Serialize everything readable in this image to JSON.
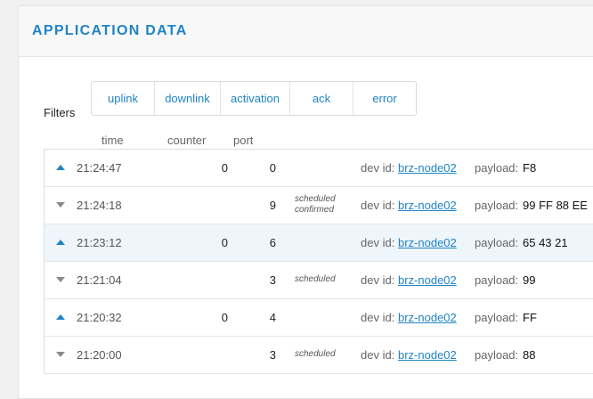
{
  "panel": {
    "title": "APPLICATION DATA"
  },
  "filters": {
    "label": "Filters",
    "buttons": [
      {
        "label": "uplink"
      },
      {
        "label": "downlink"
      },
      {
        "label": "activation"
      },
      {
        "label": "ack"
      },
      {
        "label": "error"
      }
    ]
  },
  "columns": {
    "time": "time",
    "counter": "counter",
    "port": "port"
  },
  "labels": {
    "dev_id": "dev id:",
    "payload": "payload:"
  },
  "colors": {
    "accent": "#1f84c6",
    "highlight_row": "#eef5fb",
    "uplink_arrow": "#1f84c6",
    "downlink_arrow": "#8a8a8a"
  },
  "rows": [
    {
      "direction": "uplink",
      "direction_icon": "triangle-up-icon",
      "time": "21:24:47",
      "counter": "0",
      "port": "0",
      "flags": [],
      "dev_id": "brz-node02",
      "payload": "F8"
    },
    {
      "direction": "downlink",
      "direction_icon": "triangle-down-icon",
      "time": "21:24:18",
      "counter": "",
      "port": "9",
      "flags": [
        "scheduled",
        "confirmed"
      ],
      "dev_id": "brz-node02",
      "payload": "99 FF 88 EE"
    },
    {
      "direction": "uplink",
      "direction_icon": "triangle-up-icon",
      "time": "21:23:12",
      "counter": "0",
      "port": "6",
      "flags": [],
      "dev_id": "brz-node02",
      "payload": "65 43 21",
      "highlighted": true
    },
    {
      "direction": "downlink",
      "direction_icon": "triangle-down-icon",
      "time": "21:21:04",
      "counter": "",
      "port": "3",
      "flags": [
        "scheduled"
      ],
      "dev_id": "brz-node02",
      "payload": "99"
    },
    {
      "direction": "uplink",
      "direction_icon": "triangle-up-icon",
      "time": "21:20:32",
      "counter": "0",
      "port": "4",
      "flags": [],
      "dev_id": "brz-node02",
      "payload": "FF"
    },
    {
      "direction": "downlink",
      "direction_icon": "triangle-down-icon",
      "time": "21:20:00",
      "counter": "",
      "port": "3",
      "flags": [
        "scheduled"
      ],
      "dev_id": "brz-node02",
      "payload": "88"
    }
  ]
}
